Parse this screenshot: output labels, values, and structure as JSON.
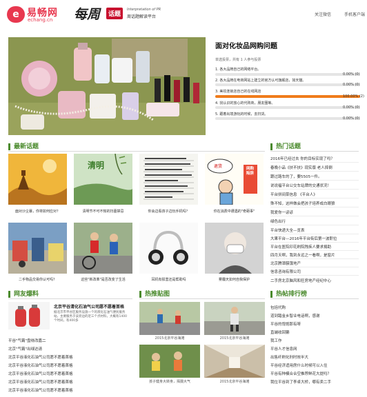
{
  "header": {
    "logo_glyph": "e",
    "logo_name": "易畅网",
    "logo_domain": "echang.cn",
    "brand_script": "每周",
    "brand_tag": "话题",
    "brand_en": "Interpretation of PR",
    "brand_cn": "周话题解读平台",
    "nav": [
      "关注微信",
      "手机客户端"
    ]
  },
  "poll": {
    "title": "面对化妆品网购问题",
    "meta": "单选投票，共有 1 人参与投票",
    "options": [
      {
        "text": "1. 各大品牌自己的网络平台。",
        "percent": 0,
        "votes": 0,
        "color": "#1f6fb5"
      },
      {
        "text": "2. 各大品牌在电商网站上建立的官方认可旗舰店，如天猫。",
        "percent": 0,
        "votes": 0,
        "color": "#1f6fb5"
      },
      {
        "text": "3. 美妆连锁店自己的在线网店",
        "percent": 100,
        "votes": 2,
        "color": "#f07c1b"
      },
      {
        "text": "4. 找认识的放心的代购商，朋友圈等。",
        "percent": 0,
        "votes": 0,
        "color": "#1f6fb5"
      },
      {
        "text": "5. 跟着出境游玩的时候，去扫货。",
        "percent": 0,
        "votes": 0,
        "color": "#1f6fb5"
      }
    ]
  },
  "latest": {
    "title": "最新话题",
    "items": [
      {
        "caption": "面对沙尘暴，你将如何应对？"
      },
      {
        "caption": "清明节不可不知的扫墓禁忌"
      },
      {
        "caption": "你会边看孩子边玩手机吗？"
      },
      {
        "caption": "你在消费中遭遇的\"奇葩事\""
      },
      {
        "caption": "二手物品交易你认可吗？"
      },
      {
        "caption": "这些\"新改革\"是否改变了生活"
      },
      {
        "caption": "耳机有损害还是帮助吗"
      },
      {
        "caption": "雾霾天如何自我保护"
      }
    ],
    "overlay_text": {
      "qingming": "清明",
      "bubble": "退货",
      "sign": "网购陷阱"
    }
  },
  "hot_topics": {
    "title": "热门话题",
    "items": [
      "2016年已经过去 你的目标实现了吗？",
      "春晚小品《扶不扶》现实版 老人摔倒",
      "跟过路车的了，要5505一件。",
      "说说福平台公交车站牌的交通状况！",
      "平台拼间菜信息 《平台人》",
      "殊不知，这样做会把孩子培养成白眼狼",
      "我爱你一谚谚",
      "绿色出行",
      "平台快递大全—览表",
      "大果平台—2016年平台街后第一波职位",
      "平台在医院印花刷院残疾人要求捐助",
      "四月天啊，我到永远之一看啊，是窗片",
      "北京腾潭膜饿地产",
      "信息咨询有限公司",
      "二手房北京脑风和狂房地产经纪中心"
    ]
  },
  "netizen": {
    "title": "网友爆料",
    "featured": {
      "title": "北京平谷清化石油气公司愿不愿着首格",
      "snippet": "据北京市平谷区服务设施一个的液化石油气便民服务站，主要服务于该旁边的近三个点材料，大概有1400个时间，有400多"
    },
    "items": [
      "平谷\"气霸\"盘绕改嘉二",
      "北京\"气霸\"出绿达请",
      "北京平谷液化石油气公司愿不愿着首格",
      "北京平谷液化石油气公司愿不愿着首格",
      "北京平谷液化石油气公司愿不愿着首格",
      "北京平谷液化石油气公司愿不愿着首格",
      "北京平谷液化石油气公司愿不愿着首格"
    ]
  },
  "hot_pics": {
    "title": "热推贴图",
    "items": [
      {
        "caption": "2015北京平谷海滩"
      },
      {
        "caption": "2015北京平谷海滩"
      },
      {
        "caption": "孩子健身大转身，揭摄大气"
      },
      {
        "caption": "2015北京平谷海滩"
      }
    ]
  },
  "ranking": {
    "title": "热帖排行榜",
    "items": [
      "包括代购",
      "道到踏金乡智业电话啊，感谢",
      "平谷的饱饱那有呀",
      "直端收回獭",
      "我工作",
      "平谷人才信息网",
      "出售纤刷化刑时效半大",
      "平谷经济适用房什么时候可以入住",
      "平谷有种模合合空推荐鲜花大提吗？",
      "我位平谷到了李卓大桥，哪有卖二手"
    ]
  },
  "colors": {
    "brand_red": "#e8384f",
    "section_green": "#4a8a2c",
    "bar_orange": "#f07c1b",
    "bar_blue": "#1f6fb5"
  }
}
